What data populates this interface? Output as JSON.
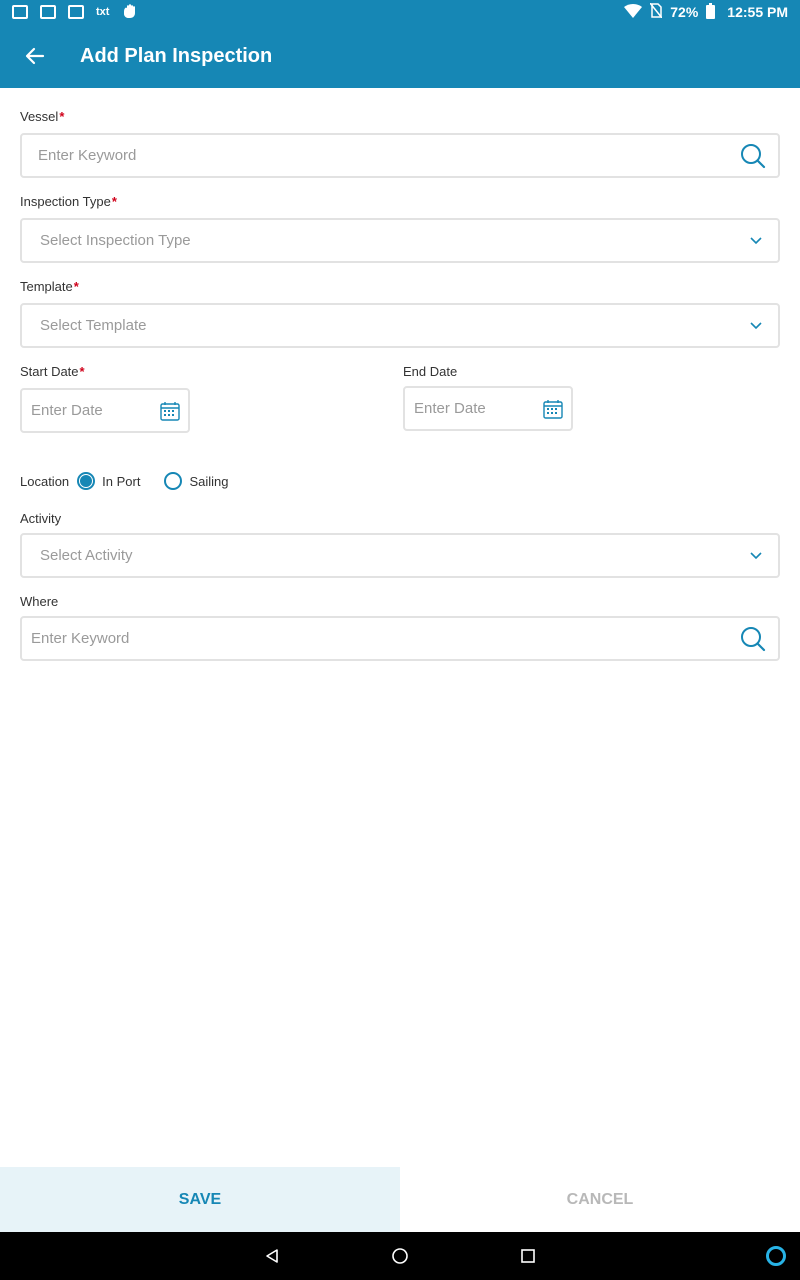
{
  "status_bar": {
    "battery": "72%",
    "time": "12:55 PM",
    "notif_text": "txt",
    "icons": [
      "gmail-icon",
      "photo-icon",
      "gmail-icon",
      "tmobile-icon",
      "hand-icon",
      "wifi-icon",
      "no-sim-icon",
      "battery-icon"
    ]
  },
  "header": {
    "title": "Add Plan Inspection",
    "back_icon": "arrow-left-icon"
  },
  "form": {
    "vessel": {
      "label": "Vessel",
      "required": "*",
      "placeholder": "Enter Keyword"
    },
    "inspection_type": {
      "label": "Inspection Type",
      "required": "*",
      "placeholder": "Select Inspection Type"
    },
    "template": {
      "label": "Template",
      "required": "*",
      "placeholder": "Select Template"
    },
    "start_date": {
      "label": "Start Date",
      "required": "*",
      "placeholder": "Enter Date"
    },
    "end_date": {
      "label": "End Date",
      "placeholder": "Enter Date"
    },
    "location": {
      "label": "Location",
      "options": [
        {
          "label": "In Port",
          "selected": true
        },
        {
          "label": "Sailing",
          "selected": false
        }
      ]
    },
    "activity": {
      "label": "Activity",
      "placeholder": "Select Activity"
    },
    "where": {
      "label": "Where",
      "placeholder": "Enter Keyword"
    }
  },
  "actions": {
    "save": "SAVE",
    "cancel": "CANCEL"
  },
  "colors": {
    "primary": "#1687b5",
    "required": "#d0021b",
    "save_bg": "#e7f3f8",
    "cancel_text": "#b8b8b8"
  }
}
